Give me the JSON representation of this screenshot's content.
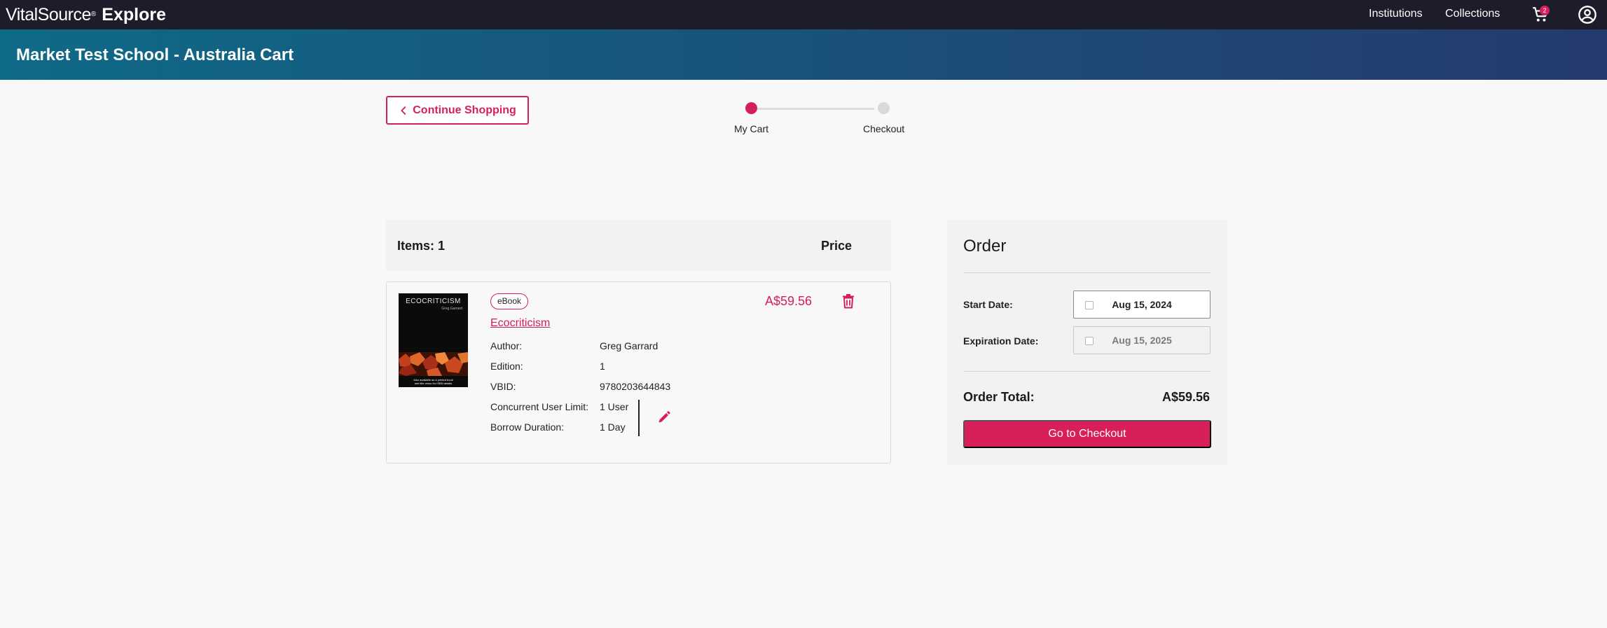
{
  "nav": {
    "brand_main": "VitalSource",
    "brand_tm": "®",
    "brand_product": "Explore",
    "links": [
      "Institutions",
      "Collections"
    ],
    "cart_count": "2",
    "cart_icon": "cart-icon",
    "account_icon": "account-circle-icon"
  },
  "header": {
    "title": "Market Test School - Australia Cart"
  },
  "continue_label": "Continue Shopping",
  "stepper": {
    "steps": [
      "My Cart",
      "Checkout"
    ],
    "active_step": 1
  },
  "cart": {
    "items_label": "Items: 1",
    "price_header": "Price",
    "item": {
      "type": "eBook",
      "title": "Ecocriticism",
      "cover": {
        "title": "ECOCRITICISM",
        "author": "Greg Garrard",
        "footer_1": "Also available as a printed book",
        "footer_2": "see title verso for ISBN details"
      },
      "price": "A$59.56",
      "details": [
        {
          "label": "Author:",
          "value": "Greg Garrard"
        },
        {
          "label": "Edition:",
          "value": "1"
        },
        {
          "label": "VBID:",
          "value": "9780203644843"
        },
        {
          "label": "Concurrent User Limit:",
          "value": "1 User"
        },
        {
          "label": "Borrow Duration:",
          "value": "1 Day"
        }
      ]
    }
  },
  "order": {
    "title": "Order",
    "start_label": "Start Date:",
    "start_value": "Aug 15, 2024",
    "expiration_label": "Expiration Date:",
    "expiration_value": "Aug 15, 2025",
    "total_label": "Order Total:",
    "total_value": "A$59.56",
    "checkout_label": "Go to Checkout"
  },
  "colors": {
    "accent": "#d31f5e",
    "nav_bg": "#1d1c2a",
    "band_start": "#0f6a87",
    "band_end": "#253a6f"
  }
}
